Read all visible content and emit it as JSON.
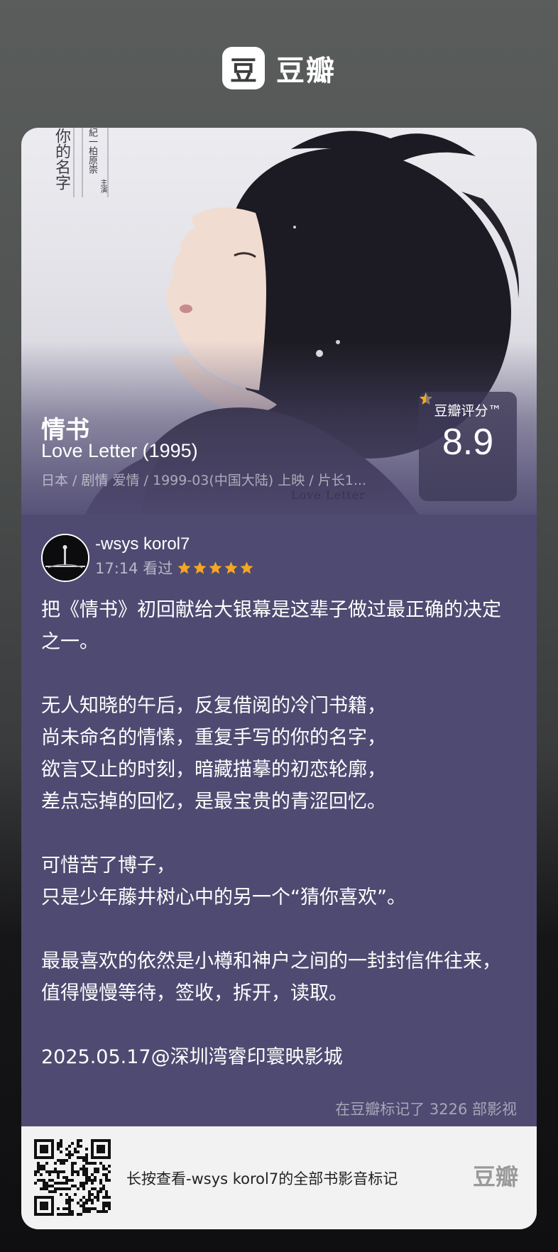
{
  "brand": {
    "logo_char": "豆",
    "name": "豆瓣"
  },
  "poster": {
    "vertical_text_main": "你的名字",
    "vertical_text_side": "紀一柏原崇",
    "vertical_text_side2": "主演",
    "love_letter_text": "Love Letter"
  },
  "movie": {
    "title": "情书",
    "english_title": "Love Letter (1995)",
    "meta": "日本 / 剧情 爱情 / 1999-03(中国大陆) 上映 / 片长1..."
  },
  "rating": {
    "label": "豆瓣评分™",
    "value": "8.9",
    "stars": 4.5
  },
  "review": {
    "username": "-wsys korol7",
    "time": "17:14 看过",
    "user_stars": 5,
    "paragraphs": [
      [
        "把《情书》初回献给大银幕是这辈子做过最正确的决定之一。"
      ],
      [
        "无人知晓的午后，反复借阅的冷门书籍，",
        "尚未命名的情愫，重复手写的你的名字，",
        "欲言又止的时刻，暗藏描摹的初恋轮廓，",
        "差点忘掉的回忆，是最宝贵的青涩回忆。"
      ],
      [
        "可惜苦了博子，",
        "只是少年藤井树心中的另一个“猜你喜欢”。"
      ],
      [
        "最最喜欢的依然是小樽和神户之间的一封封信件往来，值得慢慢等待，签收，拆开，读取。"
      ],
      [
        "2025.05.17@深圳湾睿印寰映影城"
      ]
    ],
    "marked_count": "在豆瓣标记了 3226 部影视"
  },
  "footer": {
    "text": "长按查看-wsys korol7的全部书影音标记",
    "logo": "豆瓣"
  },
  "colors": {
    "card_bg": "#4f4a71",
    "star": "#f5a623",
    "footer_bg": "#f2f2f2"
  }
}
